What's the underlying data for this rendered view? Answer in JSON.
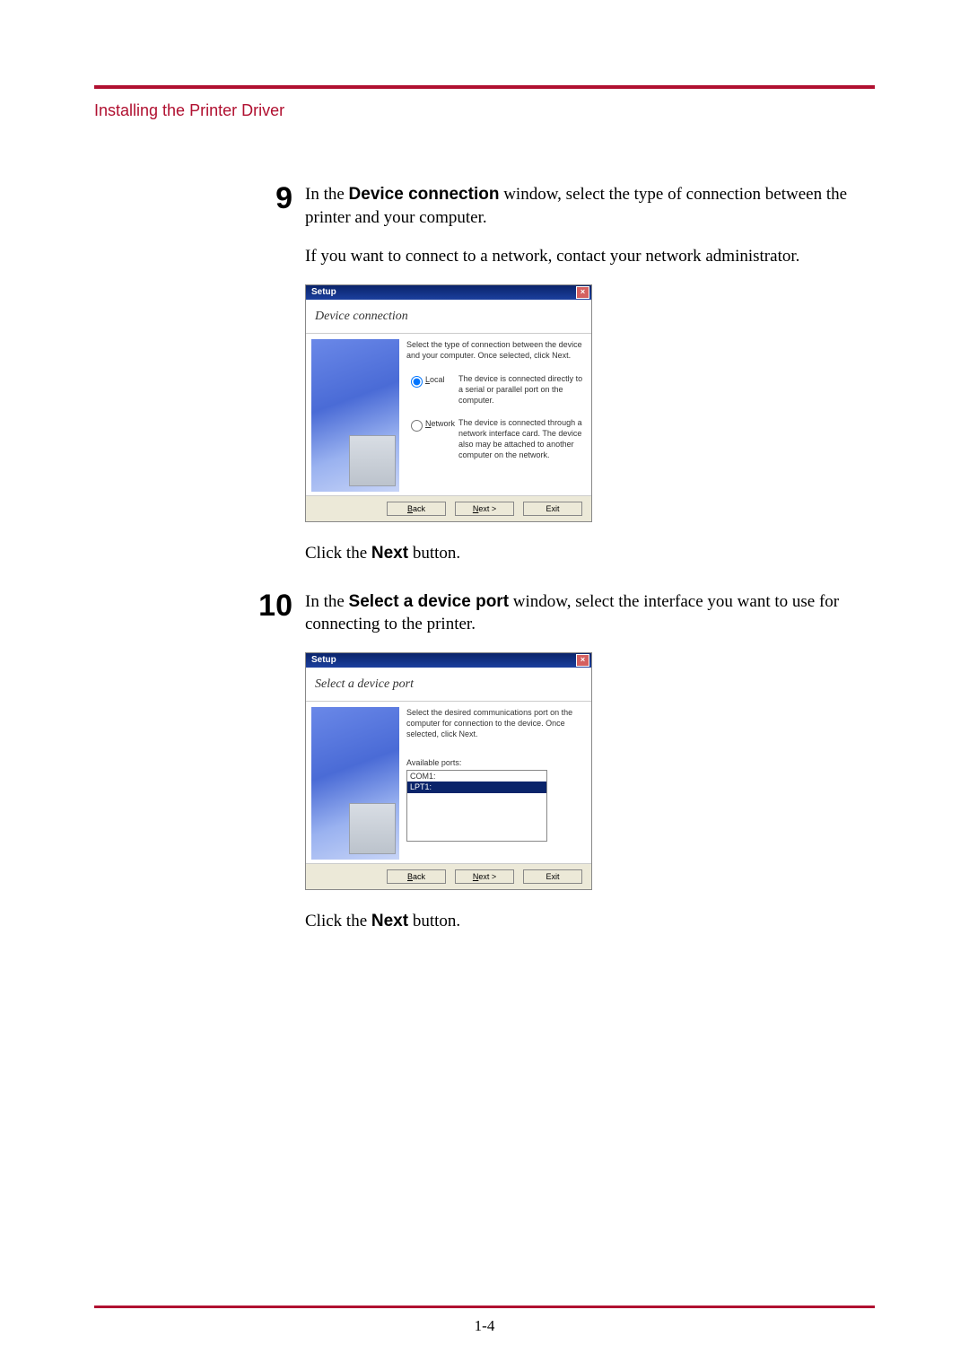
{
  "section_title": "Installing the Printer Driver",
  "page_number": "1-4",
  "steps": {
    "s9": {
      "num": "9",
      "p1_a": "In the ",
      "p1_bold": "Device connection",
      "p1_b": " window, select the type of connection between the printer and your computer.",
      "p2": "If you want to connect to a network, contact your network administrator.",
      "p3_a": "Click the ",
      "p3_bold": "Next",
      "p3_b": " button."
    },
    "s10": {
      "num": "10",
      "p1_a": "In the ",
      "p1_bold": "Select a device port",
      "p1_b": " window, select the interface you want to use for connecting to the printer.",
      "p2_a": "Click the ",
      "p2_bold": "Next",
      "p2_b": " button."
    }
  },
  "dlg_common": {
    "title": "Setup",
    "close": "×",
    "back": "< Back",
    "next": "Next >",
    "exit": "Exit"
  },
  "dlg1": {
    "heading": "Device connection",
    "desc": "Select the type of connection between the device and your computer. Once selected, click Next.",
    "local_key": "L",
    "local_label": "ocal",
    "local_text": "The device is connected directly to a serial or parallel port on the computer.",
    "network_key": "N",
    "network_label": "etwork",
    "network_text": "The device is connected through a network interface card. The device also may be attached to another computer on the network."
  },
  "dlg2": {
    "heading": "Select a device port",
    "desc": "Select the desired communications port on the computer for connection to the device. Once selected, click Next.",
    "ports_label": "Available ports:",
    "ports": [
      "COM1:",
      "LPT1:"
    ],
    "selected_index": 1
  }
}
